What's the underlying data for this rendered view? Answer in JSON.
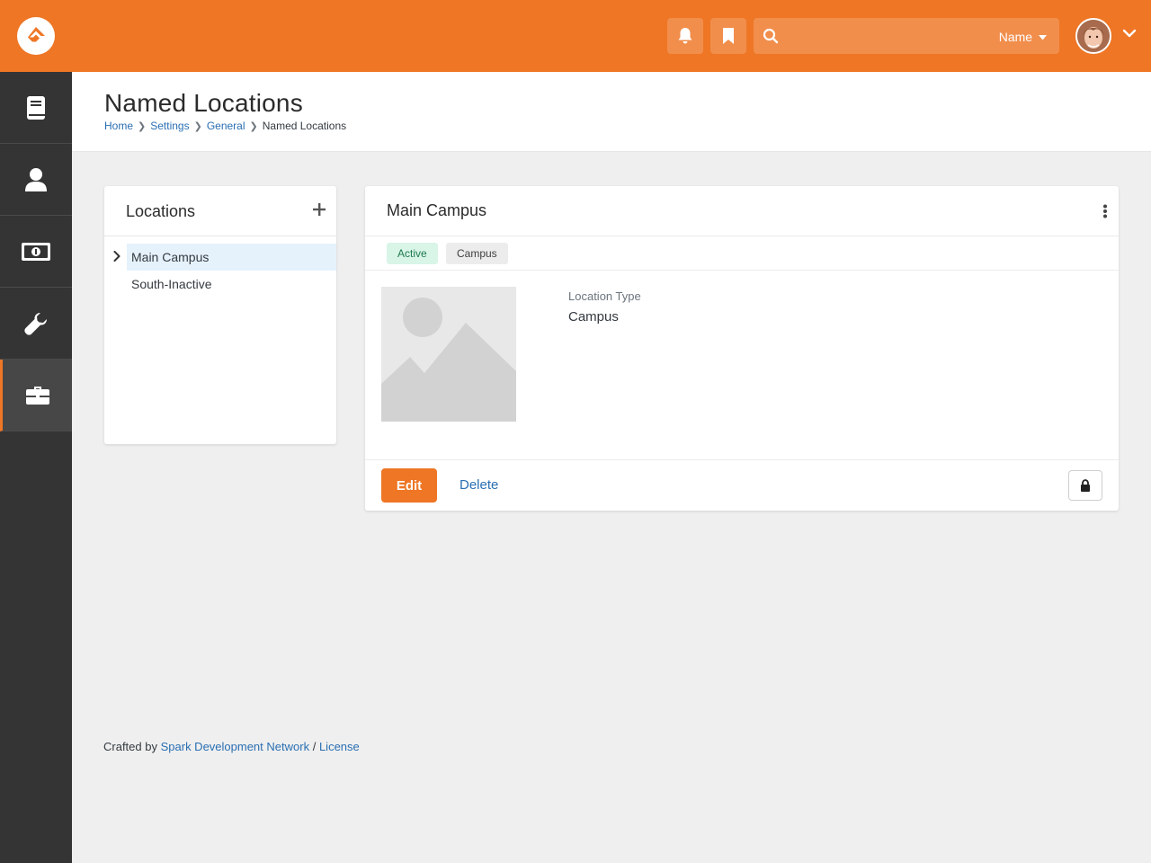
{
  "topbar": {
    "search": {
      "placeholder": "",
      "scope_label": "Name"
    },
    "colors": {
      "brand": "#ee7625"
    },
    "icons": {
      "logo": "rock-logo-icon",
      "notifications": "bell-icon",
      "bookmarks": "bookmark-icon",
      "search": "search-icon",
      "user_menu": "chevron-down-icon"
    }
  },
  "sidebar": {
    "items": [
      {
        "icon": "book-icon",
        "active": false
      },
      {
        "icon": "person-icon",
        "active": false
      },
      {
        "icon": "money-icon",
        "active": false
      },
      {
        "icon": "wrench-icon",
        "active": false
      },
      {
        "icon": "briefcase-icon",
        "active": true
      }
    ]
  },
  "page": {
    "title": "Named Locations",
    "breadcrumb": [
      "Home",
      "Settings",
      "General",
      "Named Locations"
    ]
  },
  "locations_panel": {
    "title": "Locations",
    "add_icon": "plus-icon",
    "items": [
      {
        "label": "Main Campus",
        "selected": true,
        "has_children": true
      },
      {
        "label": "South-Inactive",
        "selected": false,
        "has_children": false
      }
    ]
  },
  "detail": {
    "title": "Main Campus",
    "badges": [
      "Active",
      "Campus"
    ],
    "field_label": "Location Type",
    "field_value": "Campus",
    "edit_label": "Edit",
    "delete_label": "Delete",
    "lock_icon": "lock-icon",
    "menu_icon": "kebab-menu-icon"
  },
  "footer": {
    "prefix": "Crafted by",
    "org_link": "Spark Development Network",
    "separator": "/",
    "license_link": "License"
  }
}
